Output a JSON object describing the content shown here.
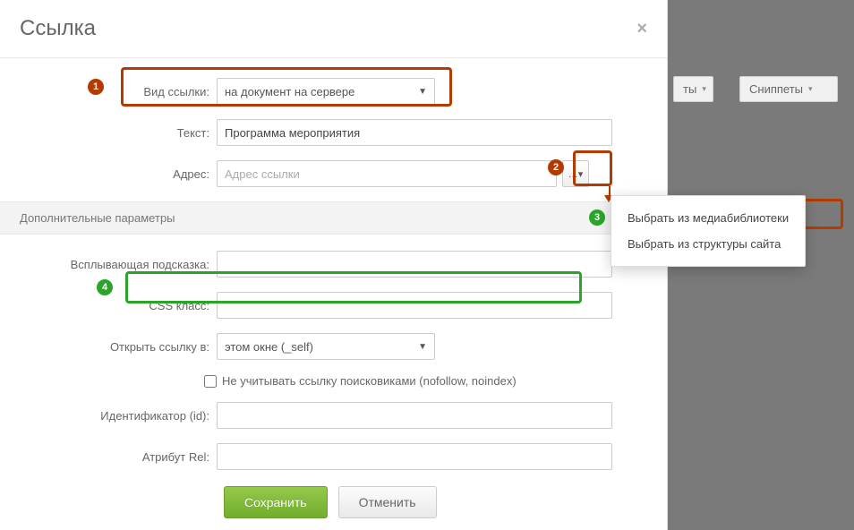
{
  "backdrop": {
    "button1_partial": "ты",
    "button2": "Сниппеты"
  },
  "dialog": {
    "title": "Ссылка",
    "fields": {
      "link_type": {
        "label": "Вид ссылки:",
        "value": "на документ на сервере"
      },
      "text": {
        "label": "Текст:",
        "value": "Программа мероприятия"
      },
      "address": {
        "label": "Адрес:",
        "placeholder": "Адрес ссылки"
      },
      "section": "Дополнительные параметры",
      "tooltip": {
        "label": "Всплывающая подсказка:"
      },
      "css_class": {
        "label": "CSS класс:"
      },
      "open_in": {
        "label": "Открыть ссылку в:",
        "value": "этом окне (_self)"
      },
      "nofollow": {
        "text": "Не учитывать ссылку поисковиками (nofollow, noindex)"
      },
      "id": {
        "label": "Идентификатор (id):"
      },
      "rel": {
        "label": "Атрибут Rel:"
      }
    },
    "browse_icon": "…▾",
    "buttons": {
      "save": "Сохранить",
      "cancel": "Отменить"
    }
  },
  "dropdown": {
    "item1": "Выбрать из медиабиблиотеки",
    "item2": "Выбрать из структуры сайта"
  },
  "callouts": {
    "c1": "1",
    "c2": "2",
    "c3": "3",
    "c4": "4"
  }
}
